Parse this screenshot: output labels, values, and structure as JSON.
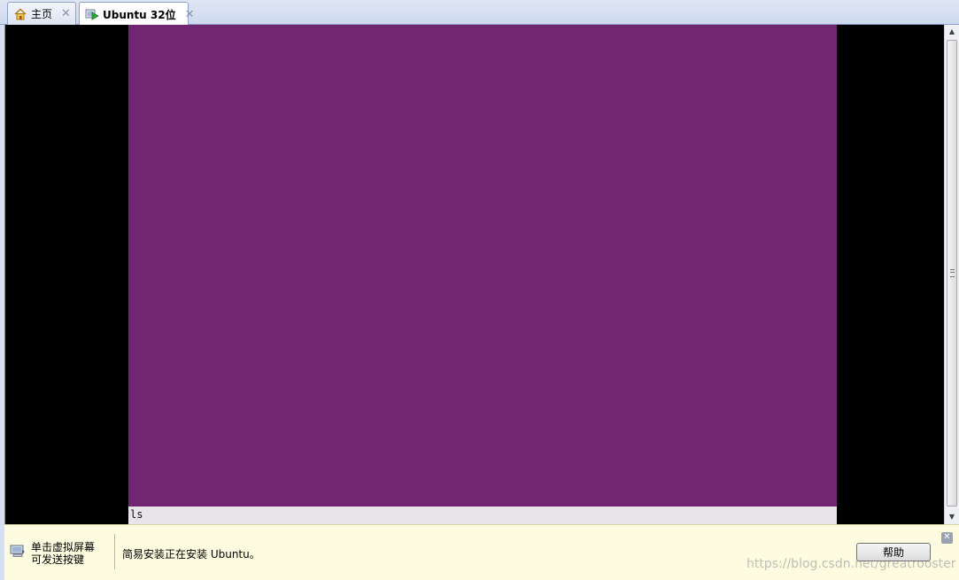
{
  "tabs": [
    {
      "label": "主页",
      "icon": "home-icon"
    },
    {
      "label": "Ubuntu 32位",
      "icon": "vm-running-icon",
      "active": true
    }
  ],
  "console": {
    "text": "ls"
  },
  "infobar": {
    "hint": "单击虚拟屏幕\n可发送按键",
    "message": "简易安装正在安装 Ubuntu。",
    "help_label": "帮助"
  },
  "watermark": "https://blog.csdn.net/greatrooster",
  "colors": {
    "vm_screen": "#722671",
    "vm_background": "#000000",
    "infobar_background": "#fdfce0"
  }
}
